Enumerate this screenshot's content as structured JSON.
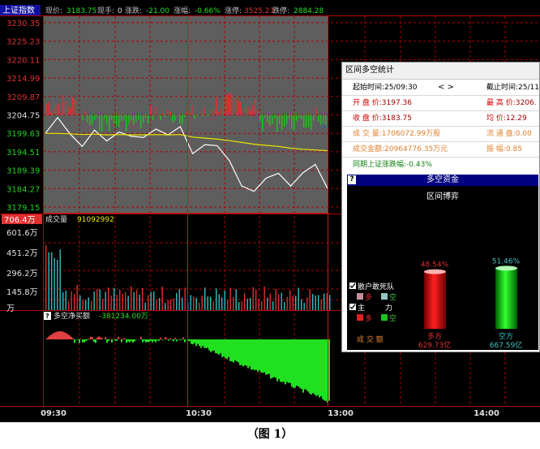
{
  "topbar": {
    "index_name": "上证指数",
    "price_label": "现价:",
    "price_value": "3183.75",
    "hand_label": "现手:",
    "hand_value": "0",
    "change_label": "涨跌:",
    "change_value": "-21.00",
    "pct_label": "涨幅:",
    "pct_value": "-0.66%",
    "limitup_label": "涨停:",
    "limitup_value": "3525.23",
    "limitdown_label": "跌停:",
    "limitdown_value": "2884.28"
  },
  "price_axis": [
    "3230.35",
    "3225.23",
    "3220.11",
    "3214.99",
    "3209.87",
    "3204.75",
    "3199.63",
    "3194.51",
    "3189.39",
    "3184.27",
    "3179.15"
  ],
  "volume_axis": {
    "header": "706.4万",
    "ticks": [
      "601.6万",
      "451.2万",
      "296.2万",
      "145.8万",
      "万"
    ]
  },
  "volume_label": "成交量",
  "volume_value": "91092992",
  "netflow_label": "多空净买额",
  "netflow_value": "-381234.00万",
  "time_axis": [
    "09:30",
    "10:30",
    "13:00",
    "14:00"
  ],
  "caption": "（图 1）",
  "colors": {
    "up": "#e03030",
    "down": "#20c020",
    "price_line": "#ffffff",
    "avg_line": "#e8e800",
    "grid": "#b00000"
  },
  "chart_data": {
    "type": "line",
    "xlabel": "",
    "ylabel": "",
    "ylim": [
      3179.15,
      3230.35
    ],
    "x": [
      "09:30",
      "09:35",
      "09:40",
      "09:45",
      "09:50",
      "09:55",
      "10:00",
      "10:05",
      "10:10",
      "10:15",
      "10:20",
      "10:25",
      "10:30",
      "10:35",
      "10:40",
      "10:45",
      "10:50",
      "10:55",
      "11:00",
      "11:05",
      "11:10",
      "11:15",
      "11:20",
      "11:25"
    ],
    "series": [
      {
        "values": [
          3199.6,
          3204.0,
          3199.5,
          3196.0,
          3200.5,
          3197.5,
          3200.0,
          3198.8,
          3198.5,
          3200.8,
          3199.2,
          3201.5,
          3194.0,
          3196.5,
          3196.2,
          3192.0,
          3185.0,
          3183.5,
          3187.2,
          3188.5,
          3185.0,
          3188.7,
          3191.0,
          3184.3
        ]
      },
      {
        "values": [
          3199.6,
          3199.6,
          3199.5,
          3199.3,
          3199.4,
          3199.2,
          3199.3,
          3199.2,
          3199.2,
          3199.3,
          3199.2,
          3199.3,
          3198.6,
          3198.3,
          3198.0,
          3197.6,
          3197.1,
          3196.6,
          3196.3,
          3196.0,
          3195.5,
          3195.2,
          3195.0,
          3194.8
        ]
      }
    ]
  },
  "popup": {
    "title": "区间多空统计",
    "start_label": "起始时间:",
    "start_value": "25/09:30",
    "nav": "<  >",
    "end_label": "截止时间:",
    "end_value": "25/11",
    "open_label": "开 盘 价:",
    "open_value": "3197.36",
    "high_label": "最 高 价:",
    "high_value": "3206.",
    "close_label": "收 盘 价:",
    "close_value": "3183.75",
    "avg_label": "均    价:",
    "avg_value": "12.29",
    "vol_label": "成 交 量:",
    "vol_value": "1706072.99万股",
    "float_label": "流 通 盘:",
    "float_value": "0.00",
    "amt_label": "成交金额:",
    "amt_value": "20964776.35万元",
    "amp_label": "振    幅:",
    "amp_value": "0.85",
    "same_label": "同期上证涨跌幅:",
    "same_value": "-0.43%",
    "panel": {
      "title": "多空资金",
      "subtitle": "区间博弈",
      "chk1": "散户敢死队",
      "multi": "多",
      "empty": "空",
      "chk2_a": "主",
      "chk2_b": "力",
      "buysell": "成 交 额",
      "long_pct": "48.54%",
      "long_label": "多方",
      "long_amt": "629.73亿",
      "short_pct": "51.46%",
      "short_label": "空方",
      "short_amt": "667.59亿"
    }
  }
}
